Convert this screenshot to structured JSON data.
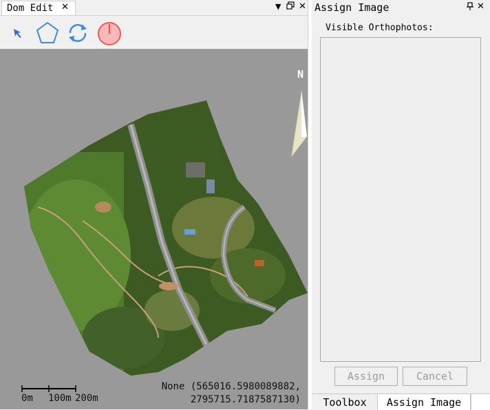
{
  "left_panel": {
    "tab_title": "Dom Edit",
    "tab_close": "✕",
    "dropdown_glyph": "▼",
    "float_glyph": "🗗",
    "close_glyph": "✕",
    "toolbar": {
      "tools": [
        "select-arrow-icon",
        "polygon-icon",
        "refresh-icon",
        "power-icon"
      ],
      "colors": {
        "select": "#2b6fd6",
        "polygon": "#3b8be6",
        "refresh": "#3b8be6",
        "power": "#e85a5a"
      }
    },
    "map": {
      "background": "#999999",
      "north_label": "N",
      "coordinates_line1": "None (565016.5980089882,",
      "coordinates_line2": "2795715.7187587130)",
      "scale_labels": [
        "0m",
        "100m",
        "200m"
      ]
    }
  },
  "right_panel": {
    "title": "Assign Image",
    "pin_glyph": "📌",
    "close_glyph": "✕",
    "visible_label": "Visible Orthophotos:",
    "assign_button": "Assign",
    "cancel_button": "Cancel",
    "bottom_tabs": [
      "Toolbox",
      "Assign Image"
    ]
  }
}
